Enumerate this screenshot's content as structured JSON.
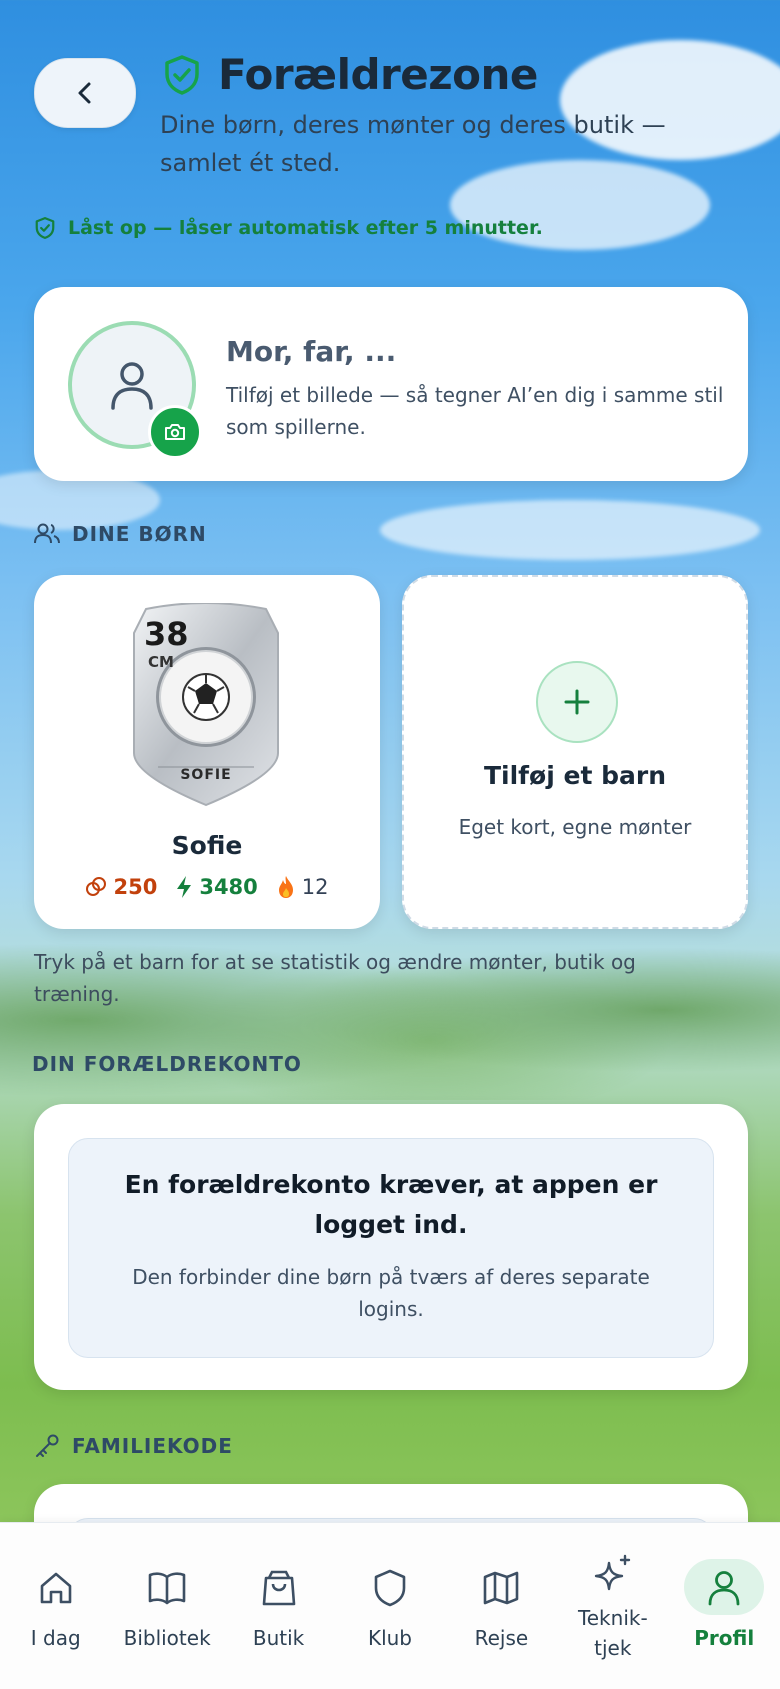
{
  "header": {
    "title": "Forældrezone",
    "subtitle": "Dine børn, deres mønter og deres butik — samlet ét sted.",
    "lock_status": "Låst op — låser automatisk efter 5 minutter."
  },
  "profile": {
    "name": "Mor, far, ...",
    "description": "Tilføj et billede — så tegner AI’en dig i samme stil som spillerne."
  },
  "children_section": {
    "label": "DINE BØRN",
    "children": [
      {
        "name": "Sofie",
        "card_rating": "38",
        "card_position": "CM",
        "card_name": "SOFIE",
        "coins": "250",
        "xp": "3480",
        "streak": "12"
      }
    ],
    "add_child": {
      "title": "Tilføj et barn",
      "subtitle": "Eget kort, egne mønter"
    },
    "hint": "Tryk på et barn for at se statistik og ændre mønter, butik og træning."
  },
  "account_section": {
    "label": "DIN FORÆLDREKONTO",
    "notice_title": "En forældrekonto kræver, at appen er logget ind.",
    "notice_body": "Den forbinder dine børn på tværs af deres separate logins."
  },
  "family_code_section": {
    "label": "FAMILIEKODE"
  },
  "tabbar": {
    "tabs": [
      {
        "label": "I dag",
        "icon": "home-icon"
      },
      {
        "label": "Bibliotek",
        "icon": "book-icon"
      },
      {
        "label": "Butik",
        "icon": "bag-icon"
      },
      {
        "label": "Klub",
        "icon": "shield-icon"
      },
      {
        "label": "Rejse",
        "icon": "map-icon"
      },
      {
        "label": "Teknik-tjek",
        "icon": "sparkles-icon"
      },
      {
        "label": "Profil",
        "icon": "person-icon",
        "active": true
      }
    ]
  },
  "colors": {
    "accent_green": "#15803d",
    "coin_orange": "#c2410c",
    "xp_green": "#15803d"
  }
}
